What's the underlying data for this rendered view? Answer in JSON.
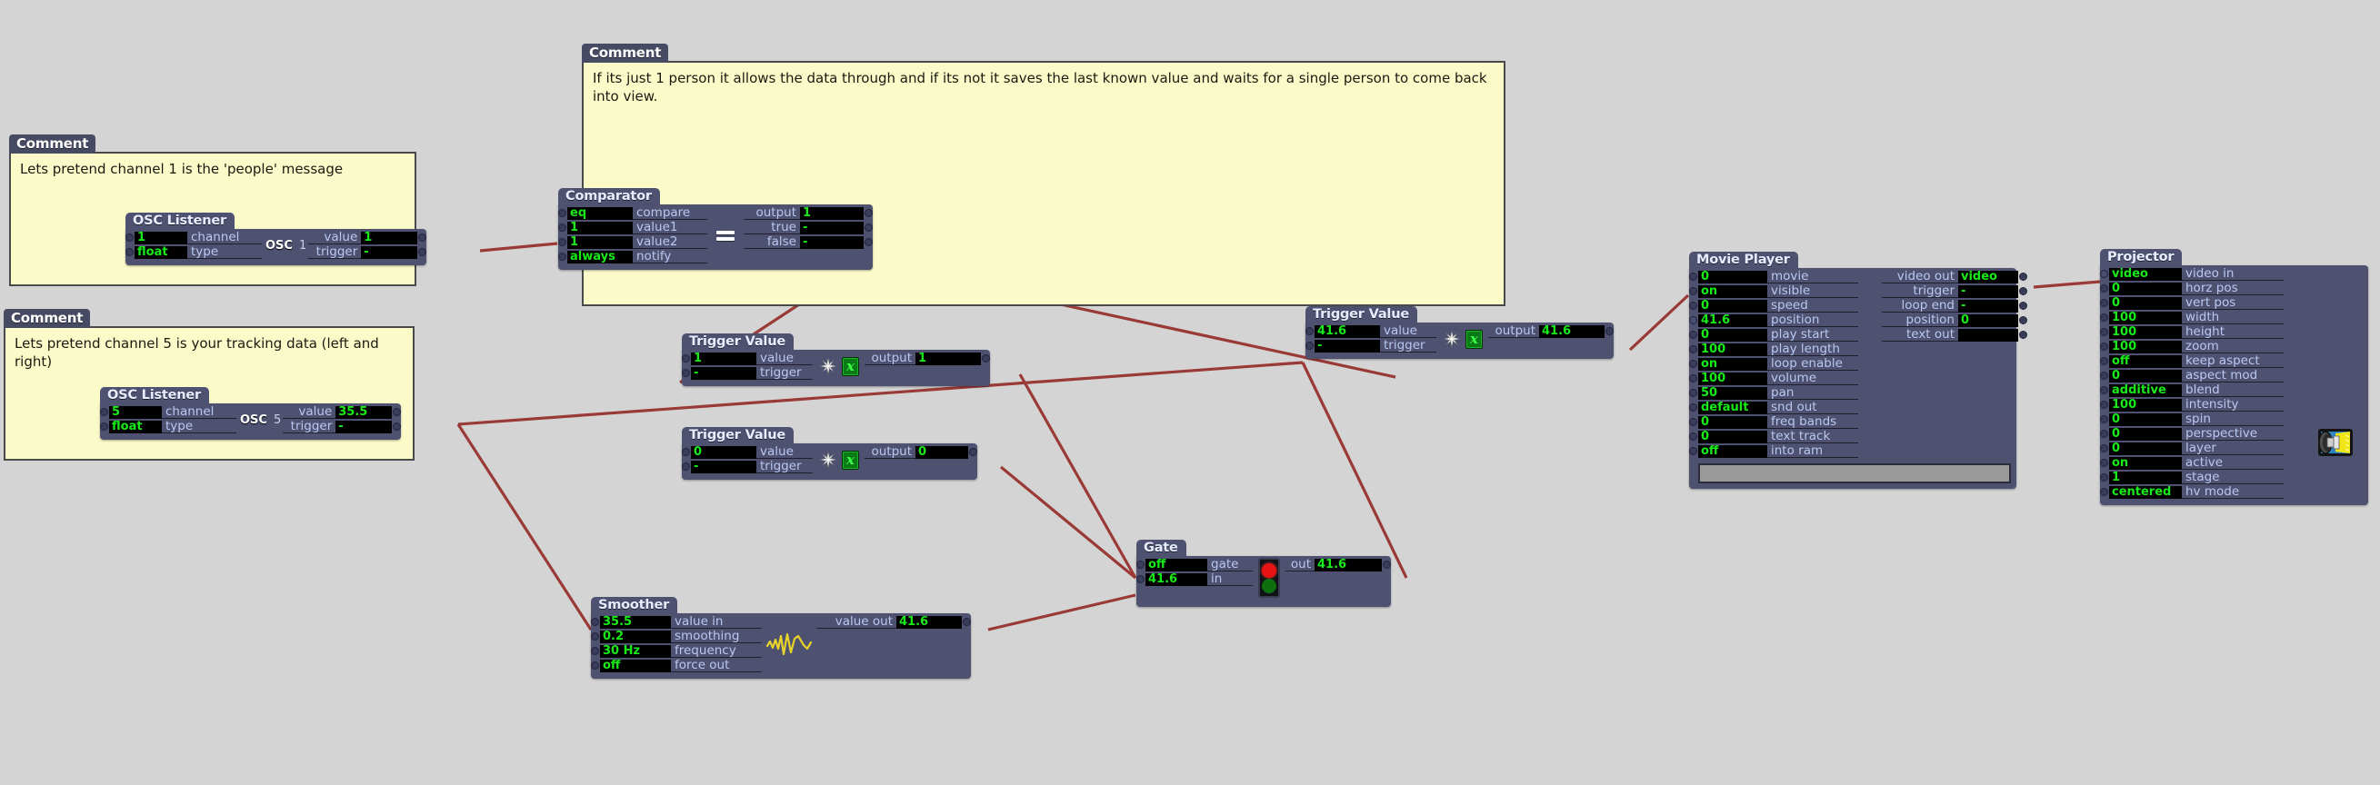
{
  "canvas": {
    "background": "#d4d4d4",
    "wire_color": "#9a3a36",
    "node_color": "#4e5170",
    "field_text_color": "#19ea19",
    "comment_bg": "#fbfbca"
  },
  "comments": [
    {
      "tab": "Comment",
      "text": "Lets pretend channel 1 is the 'people' message"
    },
    {
      "tab": "Comment",
      "text": "If its just 1 person it allows the data through and if its not it saves the last known value and waits for a single person to come back into view."
    },
    {
      "tab": "Comment",
      "text": "Lets pretend channel 5 is your tracking data (left and right)"
    }
  ],
  "nodes": {
    "osc_listener_1": {
      "title": "OSC Listener",
      "icon": "osc-icon",
      "icon_number": "1",
      "inputs": [
        {
          "value": "1",
          "label": "channel"
        },
        {
          "value": "float",
          "label": "type"
        }
      ],
      "outputs": [
        {
          "label": "value",
          "value": "1"
        },
        {
          "label": "trigger",
          "value": "-"
        }
      ]
    },
    "osc_listener_5": {
      "title": "OSC Listener",
      "icon": "osc-icon",
      "icon_number": "5",
      "inputs": [
        {
          "value": "5",
          "label": "channel"
        },
        {
          "value": "float",
          "label": "type"
        }
      ],
      "outputs": [
        {
          "label": "value",
          "value": "35.5"
        },
        {
          "label": "trigger",
          "value": "-"
        }
      ]
    },
    "comparator": {
      "title": "Comparator",
      "icon": "equals-icon",
      "inputs": [
        {
          "value": "eq",
          "label": "compare"
        },
        {
          "value": "1",
          "label": "value1"
        },
        {
          "value": "1",
          "label": "value2"
        },
        {
          "value": "always",
          "label": "notify"
        }
      ],
      "outputs": [
        {
          "label": "output",
          "value": "1"
        },
        {
          "label": "true",
          "value": "-"
        },
        {
          "label": "false",
          "value": "-"
        }
      ]
    },
    "trigger_value_a": {
      "title": "Trigger Value",
      "icon": "sparkle-icon",
      "icon2": "x-variable-icon",
      "icon2_label": "x",
      "inputs": [
        {
          "value": "1",
          "label": "value"
        },
        {
          "value": "-",
          "label": "trigger"
        }
      ],
      "outputs": [
        {
          "label": "output",
          "value": "1"
        }
      ]
    },
    "trigger_value_b": {
      "title": "Trigger Value",
      "icon": "sparkle-icon",
      "icon2": "x-variable-icon",
      "icon2_label": "x",
      "inputs": [
        {
          "value": "0",
          "label": "value"
        },
        {
          "value": "-",
          "label": "trigger"
        }
      ],
      "outputs": [
        {
          "label": "output",
          "value": "0"
        }
      ]
    },
    "trigger_value_c": {
      "title": "Trigger Value",
      "icon": "sparkle-icon",
      "icon2": "x-variable-icon",
      "icon2_label": "x",
      "inputs": [
        {
          "value": "41.6",
          "label": "value"
        },
        {
          "value": "-",
          "label": "trigger"
        }
      ],
      "outputs": [
        {
          "label": "output",
          "value": "41.6"
        }
      ]
    },
    "gate": {
      "title": "Gate",
      "icon": "traffic-light-icon",
      "inputs": [
        {
          "value": "off",
          "label": "gate"
        },
        {
          "value": "41.6",
          "label": "in"
        }
      ],
      "outputs": [
        {
          "label": "out",
          "value": "41.6"
        }
      ]
    },
    "smoother": {
      "title": "Smoother",
      "icon": "waveform-icon",
      "inputs": [
        {
          "value": "35.5",
          "label": "value in"
        },
        {
          "value": "0.2",
          "label": "smoothing"
        },
        {
          "value": "30 Hz",
          "label": "frequency"
        },
        {
          "value": "off",
          "label": "force out"
        }
      ],
      "outputs": [
        {
          "label": "value out",
          "value": "41.6"
        }
      ]
    },
    "movie_player": {
      "title": "Movie Player",
      "inputs": [
        {
          "value": "0",
          "label": "movie"
        },
        {
          "value": "on",
          "label": "visible"
        },
        {
          "value": "0",
          "label": "speed"
        },
        {
          "value": "41.6",
          "label": "position"
        },
        {
          "value": "0",
          "label": "play start"
        },
        {
          "value": "100",
          "label": "play length"
        },
        {
          "value": "on",
          "label": "loop enable"
        },
        {
          "value": "100",
          "label": "volume"
        },
        {
          "value": "50",
          "label": "pan"
        },
        {
          "value": "default",
          "label": "snd out"
        },
        {
          "value": "0",
          "label": "freq bands"
        },
        {
          "value": "0",
          "label": "text track"
        },
        {
          "value": "off",
          "label": "into ram"
        }
      ],
      "outputs": [
        {
          "label": "video out",
          "value": "video"
        },
        {
          "label": "trigger",
          "value": "-"
        },
        {
          "label": "loop end",
          "value": "-"
        },
        {
          "label": "position",
          "value": "0"
        },
        {
          "label": "text out",
          "value": ""
        }
      ]
    },
    "projector": {
      "title": "Projector",
      "icon": "projector-icon",
      "inputs": [
        {
          "value": "video",
          "label": "video in"
        },
        {
          "value": "0",
          "label": "horz pos"
        },
        {
          "value": "0",
          "label": "vert pos"
        },
        {
          "value": "100",
          "label": "width"
        },
        {
          "value": "100",
          "label": "height"
        },
        {
          "value": "100",
          "label": "zoom"
        },
        {
          "value": "off",
          "label": "keep aspect"
        },
        {
          "value": "0",
          "label": "aspect mod"
        },
        {
          "value": "additive",
          "label": "blend"
        },
        {
          "value": "100",
          "label": "intensity"
        },
        {
          "value": "0",
          "label": "spin"
        },
        {
          "value": "0",
          "label": "perspective"
        },
        {
          "value": "0",
          "label": "layer"
        },
        {
          "value": "on",
          "label": "active"
        },
        {
          "value": "1",
          "label": "stage"
        },
        {
          "value": "centered",
          "label": "hv mode"
        }
      ],
      "outputs": []
    }
  }
}
